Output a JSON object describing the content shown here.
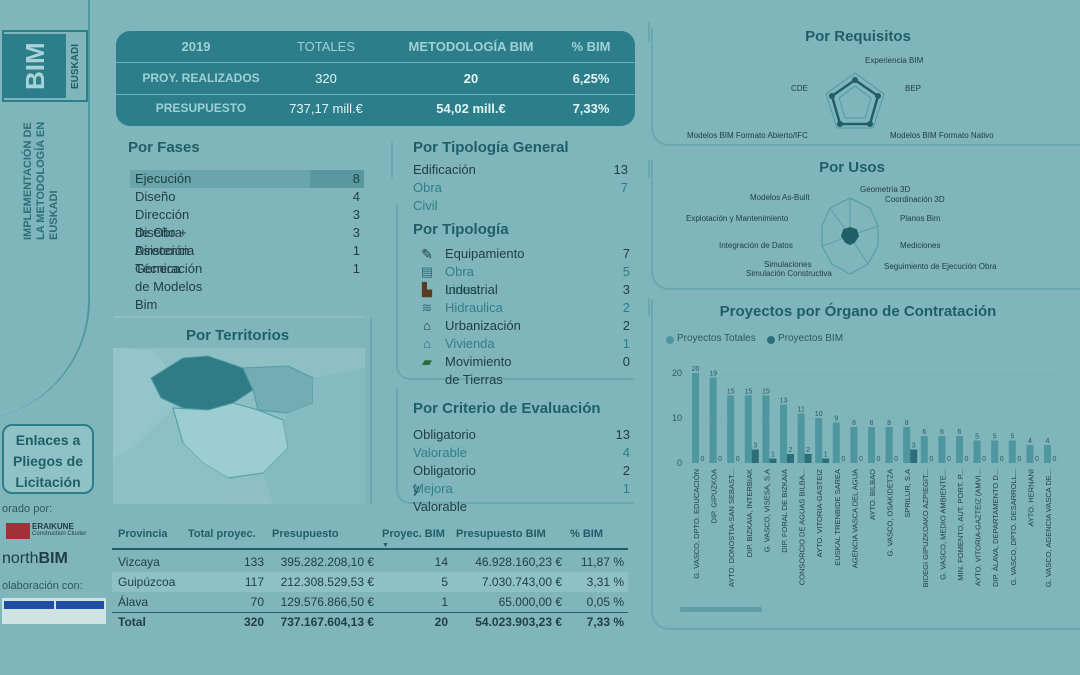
{
  "sidebar": {
    "logo_main": "BIM",
    "logo_sub": "EUSKADI",
    "implementacion": "IMPLEMENTACIÓN DE LA METODOLOGÍA EN EUSKADI",
    "enlaces_line1": "Enlaces a",
    "enlaces_line2": "Pliegos de",
    "enlaces_line3": "Licitación",
    "elaborado_label": "orado por:",
    "eraikune": "ERAIKUNE",
    "eraikune_sub": "Construction Cluster",
    "northbim_a": "north",
    "northbim_b": "BIM",
    "colaboracion_label": "olaboración con:"
  },
  "summary": {
    "headers": [
      "2019",
      "TOTALES",
      "METODOLOGÍA BIM",
      "% BIM"
    ],
    "rows": [
      {
        "label": "PROY. REALIZADOS",
        "total": "320",
        "bim": "20",
        "pct": "6,25%"
      },
      {
        "label": "PRESUPUESTO",
        "total": "737,17 mill.€",
        "bim": "54,02 mill.€",
        "pct": "7,33%"
      }
    ]
  },
  "fases": {
    "title": "Por Fases",
    "items": [
      {
        "label": "Ejecución",
        "value": "8"
      },
      {
        "label": "Diseño",
        "value": "4"
      },
      {
        "label": "Dirección de Obra",
        "value": "3"
      },
      {
        "label": "Diseño + Dirección",
        "value": "3"
      },
      {
        "label": "Asistencia Técnica",
        "value": "1"
      },
      {
        "label": "Generación de Modelos Bim",
        "value": "1"
      }
    ]
  },
  "tipologia_general": {
    "title": "Por Tipología General",
    "items": [
      {
        "label": "Edificación",
        "value": "13"
      },
      {
        "label": "Obra Civil",
        "value": "7"
      }
    ]
  },
  "tipologia": {
    "title": "Por Tipología",
    "items": [
      {
        "label": "Equipamiento",
        "value": "7",
        "icon": "pencil-icon"
      },
      {
        "label": "Obra Lineal",
        "value": "5",
        "icon": "road-icon"
      },
      {
        "label": "Industrial",
        "value": "3",
        "icon": "factory-icon"
      },
      {
        "label": "Hidraulica",
        "value": "2",
        "icon": "wave-icon"
      },
      {
        "label": "Urbanización",
        "value": "2",
        "icon": "buildings-icon"
      },
      {
        "label": "Vivienda",
        "value": "1",
        "icon": "house-icon"
      },
      {
        "label": "Movimiento de Tierras",
        "value": "0",
        "icon": "excavator-icon"
      }
    ]
  },
  "territorios": {
    "title": "Por Territorios"
  },
  "criterio": {
    "title": "Por Criterio de Evaluación",
    "items": [
      {
        "label": "Obligatorio",
        "value": "13"
      },
      {
        "label": "Valorable",
        "value": "4"
      },
      {
        "label": "Obligatorio y Valorable",
        "value": "2"
      },
      {
        "label": "Mejora",
        "value": "1"
      }
    ]
  },
  "provincias": {
    "headers": [
      "Provincia",
      "Total proyec.",
      "Presupuesto",
      "Proyec. BIM",
      "Presupuesto BIM",
      "% BIM"
    ],
    "rows": [
      [
        "Vizcaya",
        "133",
        "395.282.208,10 €",
        "14",
        "46.928.160,23 €",
        "11,87 %"
      ],
      [
        "Guipúzcoa",
        "117",
        "212.308.529,53 €",
        "5",
        "7.030.743,00 €",
        "3,31 %"
      ],
      [
        "Álava",
        "70",
        "129.576.866,50 €",
        "1",
        "65.000,00 €",
        "0,05 %"
      ]
    ],
    "total": [
      "Total",
      "320",
      "737.167.604,13 €",
      "20",
      "54.023.903,23 €",
      "7,33 %"
    ]
  },
  "requisitos": {
    "title": "Por Requisitos",
    "labels": [
      "Experiencia BIM",
      "BEP",
      "Modelos BIM Formato Nativo",
      "Modelos BIM Formato Abierto/IFC",
      "CDE"
    ]
  },
  "usos": {
    "title": "Por Usos",
    "labels": [
      "Geometría 3D",
      "Coordinación 3D",
      "Planos Bim",
      "Mediciones",
      "Seguimiento de Ejecución Obra",
      "Simulación Constructiva",
      "Simulaciones",
      "Integración de Datos",
      "Explotación y Mantenimiento",
      "Modelos As-Built"
    ]
  },
  "organo": {
    "title": "Proyectos por Órgano de Contratación",
    "legend": [
      "Proyectos Totales",
      "Proyectos BIM"
    ]
  },
  "colors": {
    "accent": "#2c7f8a",
    "background": "#7fb5bb",
    "bar_total": "#4e97a0",
    "bar_bim": "#2c6f78"
  },
  "chart_data": {
    "type": "bar",
    "title": "Proyectos por Órgano de Contratación",
    "categories": [
      "G. VASCO, DPTO. EDUCACIÓN",
      "DIP. GIPUZKOA",
      "AYTO. DONOSTIA-SAN SEBAST...",
      "DIP. BIZKAIA, INTERBIAK",
      "G. VASCO, VISESA, S.A",
      "DIP. FORAL DE BIZKAIA",
      "CONSORCIO DE AGUAS BILBA...",
      "AYTO. VITORIA-GASTEIZ",
      "EUSKAL TRENBIDE SAREA",
      "AGENCIA VASCA DEL AGUA",
      "AYTO. BILBAO",
      "G. VASCO, OSAKIDETZA",
      "SPRILUR, S.A",
      "BIDEGI GIPUZKOAKO AZPIEGIT...",
      "G. VASCO, MEDIO AMBIENTE...",
      "MIN. FOMENTO, AUT. PORT. P...",
      "AYTO. VITORIA-GAZTEIZ (AMVI...",
      "DIP. ÁLAVA, DEPARTAMENTO D...",
      "G. VASCO, DPTO. DESARROLL...",
      "AYTO. HERNANI",
      "G. VASCO, AGENCIA VASCA DE..."
    ],
    "series": [
      {
        "name": "Proyectos Totales",
        "values": [
          20,
          19,
          15,
          15,
          15,
          13,
          11,
          10,
          9,
          8,
          8,
          8,
          8,
          6,
          6,
          6,
          5,
          5,
          5,
          4,
          4
        ]
      },
      {
        "name": "Proyectos BIM",
        "values": [
          0,
          0,
          0,
          3,
          1,
          2,
          2,
          1,
          0,
          0,
          0,
          0,
          3,
          0,
          0,
          0,
          0,
          0,
          0,
          0,
          0
        ]
      }
    ],
    "yticks": [
      "0",
      "10",
      "20"
    ],
    "ylim": [
      0,
      20
    ]
  }
}
